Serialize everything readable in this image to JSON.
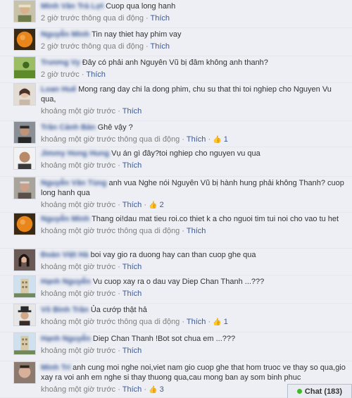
{
  "comments": [
    {
      "name": "Minh Văn Trà Lợi",
      "text": "Cuop qua long hanh",
      "time": "2 giờ trước thông qua di động",
      "like": "Thích",
      "likes": "",
      "avatar": "person-hat"
    },
    {
      "name": "Nguyễn Minh",
      "text": "Tin nay thiet hay phim vay",
      "time": "2 giờ trước thông qua di động",
      "like": "Thích",
      "likes": "",
      "avatar": "orange-sun"
    },
    {
      "name": "Trương Vy",
      "text": "Đây có phải anh Nguyên Vũ bị đâm không anh thanh?",
      "time": "2 giờ trước",
      "like": "Thích",
      "likes": "",
      "avatar": "green-field"
    },
    {
      "name": "Loan Huế",
      "text": "Mong rang day chi la dong phim, chu su that thi toi nghiep cho Nguyen Vu qua,",
      "time": "khoảng một giờ trước",
      "like": "Thích",
      "likes": "",
      "avatar": "woman"
    },
    {
      "name": "Trần Cảnh Bản",
      "text": "Ghê vậy ?",
      "time": "khoảng một giờ trước thông qua di động",
      "like": "Thích",
      "likes": "1",
      "avatar": "man-dark"
    },
    {
      "name": "Jimmy Hong Hung",
      "text": "Vụ án gì đây?toi nghiep cho nguyen vu qua",
      "time": "khoảng một giờ trước",
      "like": "Thích",
      "likes": "",
      "avatar": "man-bald"
    },
    {
      "name": "Nguyễn Văn Tùng",
      "text": "anh vua Nghe nói Nguyên Vũ bị hành hung phải không Thanh? cuop long hanh qua",
      "time": "khoảng một giờ trước",
      "like": "Thích",
      "likes": "2",
      "avatar": "man-old"
    },
    {
      "name": "Nguyễn Minh",
      "text": "Thang oi!dau mat tieu roi.co thiet k a cho nguoi tim tui noi cho vao tu het",
      "time": "khoảng một giờ trước thông qua di động",
      "like": "Thích",
      "likes": "",
      "avatar": "orange-sun"
    },
    {
      "name": "Đoàn Việt Hà",
      "text": "boi vay gio ra duong hay can than cuop ghe qua",
      "time": "khoảng một giờ trước",
      "like": "Thích",
      "likes": "",
      "avatar": "woman-dark"
    },
    {
      "name": "Hạnh Nguyễn",
      "text": "Vu cuop xay ra o dau vay Diep Chan Thanh ...???",
      "time": "khoảng một giờ trước",
      "like": "Thích",
      "likes": "",
      "avatar": "tower"
    },
    {
      "name": "Võ Bình Trần",
      "text": "Ủa cướp thật hả",
      "time": "khoảng một giờ trước thông qua di động",
      "like": "Thích",
      "likes": "1",
      "avatar": "man-hat"
    },
    {
      "name": "Hạnh Nguyễn",
      "text": "Diep Chan Thanh !Bot sot chua em ...???",
      "time": "khoảng một giờ trước",
      "like": "Thích",
      "likes": "",
      "avatar": "tower"
    },
    {
      "name": "Minh Trí",
      "text": "anh cung moi nghe noi,viet nam gio cuop ghe that hom truoc ve thay so qua,gio xay ra voi anh em nghe si thay thuong qua,cau mong ban ay som binh phuc",
      "time": "khoảng một giờ trước",
      "like": "Thích",
      "likes": "3",
      "avatar": "man-face"
    }
  ],
  "chat": {
    "label": "Chat (183)"
  },
  "colors": {
    "link": "#3b5998",
    "meta": "#808080",
    "background": "#edeff4"
  }
}
